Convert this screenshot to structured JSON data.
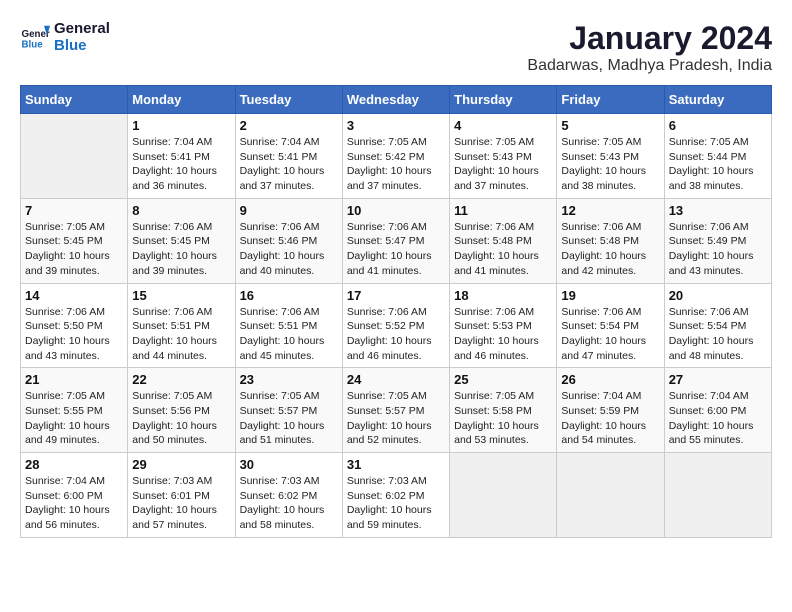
{
  "logo": {
    "line1": "General",
    "line2": "Blue"
  },
  "title": "January 2024",
  "subtitle": "Badarwas, Madhya Pradesh, India",
  "headers": [
    "Sunday",
    "Monday",
    "Tuesday",
    "Wednesday",
    "Thursday",
    "Friday",
    "Saturday"
  ],
  "weeks": [
    [
      {
        "day": "",
        "info": ""
      },
      {
        "day": "1",
        "info": "Sunrise: 7:04 AM\nSunset: 5:41 PM\nDaylight: 10 hours\nand 36 minutes."
      },
      {
        "day": "2",
        "info": "Sunrise: 7:04 AM\nSunset: 5:41 PM\nDaylight: 10 hours\nand 37 minutes."
      },
      {
        "day": "3",
        "info": "Sunrise: 7:05 AM\nSunset: 5:42 PM\nDaylight: 10 hours\nand 37 minutes."
      },
      {
        "day": "4",
        "info": "Sunrise: 7:05 AM\nSunset: 5:43 PM\nDaylight: 10 hours\nand 37 minutes."
      },
      {
        "day": "5",
        "info": "Sunrise: 7:05 AM\nSunset: 5:43 PM\nDaylight: 10 hours\nand 38 minutes."
      },
      {
        "day": "6",
        "info": "Sunrise: 7:05 AM\nSunset: 5:44 PM\nDaylight: 10 hours\nand 38 minutes."
      }
    ],
    [
      {
        "day": "7",
        "info": "Sunrise: 7:05 AM\nSunset: 5:45 PM\nDaylight: 10 hours\nand 39 minutes."
      },
      {
        "day": "8",
        "info": "Sunrise: 7:06 AM\nSunset: 5:45 PM\nDaylight: 10 hours\nand 39 minutes."
      },
      {
        "day": "9",
        "info": "Sunrise: 7:06 AM\nSunset: 5:46 PM\nDaylight: 10 hours\nand 40 minutes."
      },
      {
        "day": "10",
        "info": "Sunrise: 7:06 AM\nSunset: 5:47 PM\nDaylight: 10 hours\nand 41 minutes."
      },
      {
        "day": "11",
        "info": "Sunrise: 7:06 AM\nSunset: 5:48 PM\nDaylight: 10 hours\nand 41 minutes."
      },
      {
        "day": "12",
        "info": "Sunrise: 7:06 AM\nSunset: 5:48 PM\nDaylight: 10 hours\nand 42 minutes."
      },
      {
        "day": "13",
        "info": "Sunrise: 7:06 AM\nSunset: 5:49 PM\nDaylight: 10 hours\nand 43 minutes."
      }
    ],
    [
      {
        "day": "14",
        "info": "Sunrise: 7:06 AM\nSunset: 5:50 PM\nDaylight: 10 hours\nand 43 minutes."
      },
      {
        "day": "15",
        "info": "Sunrise: 7:06 AM\nSunset: 5:51 PM\nDaylight: 10 hours\nand 44 minutes."
      },
      {
        "day": "16",
        "info": "Sunrise: 7:06 AM\nSunset: 5:51 PM\nDaylight: 10 hours\nand 45 minutes."
      },
      {
        "day": "17",
        "info": "Sunrise: 7:06 AM\nSunset: 5:52 PM\nDaylight: 10 hours\nand 46 minutes."
      },
      {
        "day": "18",
        "info": "Sunrise: 7:06 AM\nSunset: 5:53 PM\nDaylight: 10 hours\nand 46 minutes."
      },
      {
        "day": "19",
        "info": "Sunrise: 7:06 AM\nSunset: 5:54 PM\nDaylight: 10 hours\nand 47 minutes."
      },
      {
        "day": "20",
        "info": "Sunrise: 7:06 AM\nSunset: 5:54 PM\nDaylight: 10 hours\nand 48 minutes."
      }
    ],
    [
      {
        "day": "21",
        "info": "Sunrise: 7:05 AM\nSunset: 5:55 PM\nDaylight: 10 hours\nand 49 minutes."
      },
      {
        "day": "22",
        "info": "Sunrise: 7:05 AM\nSunset: 5:56 PM\nDaylight: 10 hours\nand 50 minutes."
      },
      {
        "day": "23",
        "info": "Sunrise: 7:05 AM\nSunset: 5:57 PM\nDaylight: 10 hours\nand 51 minutes."
      },
      {
        "day": "24",
        "info": "Sunrise: 7:05 AM\nSunset: 5:57 PM\nDaylight: 10 hours\nand 52 minutes."
      },
      {
        "day": "25",
        "info": "Sunrise: 7:05 AM\nSunset: 5:58 PM\nDaylight: 10 hours\nand 53 minutes."
      },
      {
        "day": "26",
        "info": "Sunrise: 7:04 AM\nSunset: 5:59 PM\nDaylight: 10 hours\nand 54 minutes."
      },
      {
        "day": "27",
        "info": "Sunrise: 7:04 AM\nSunset: 6:00 PM\nDaylight: 10 hours\nand 55 minutes."
      }
    ],
    [
      {
        "day": "28",
        "info": "Sunrise: 7:04 AM\nSunset: 6:00 PM\nDaylight: 10 hours\nand 56 minutes."
      },
      {
        "day": "29",
        "info": "Sunrise: 7:03 AM\nSunset: 6:01 PM\nDaylight: 10 hours\nand 57 minutes."
      },
      {
        "day": "30",
        "info": "Sunrise: 7:03 AM\nSunset: 6:02 PM\nDaylight: 10 hours\nand 58 minutes."
      },
      {
        "day": "31",
        "info": "Sunrise: 7:03 AM\nSunset: 6:02 PM\nDaylight: 10 hours\nand 59 minutes."
      },
      {
        "day": "",
        "info": ""
      },
      {
        "day": "",
        "info": ""
      },
      {
        "day": "",
        "info": ""
      }
    ]
  ]
}
